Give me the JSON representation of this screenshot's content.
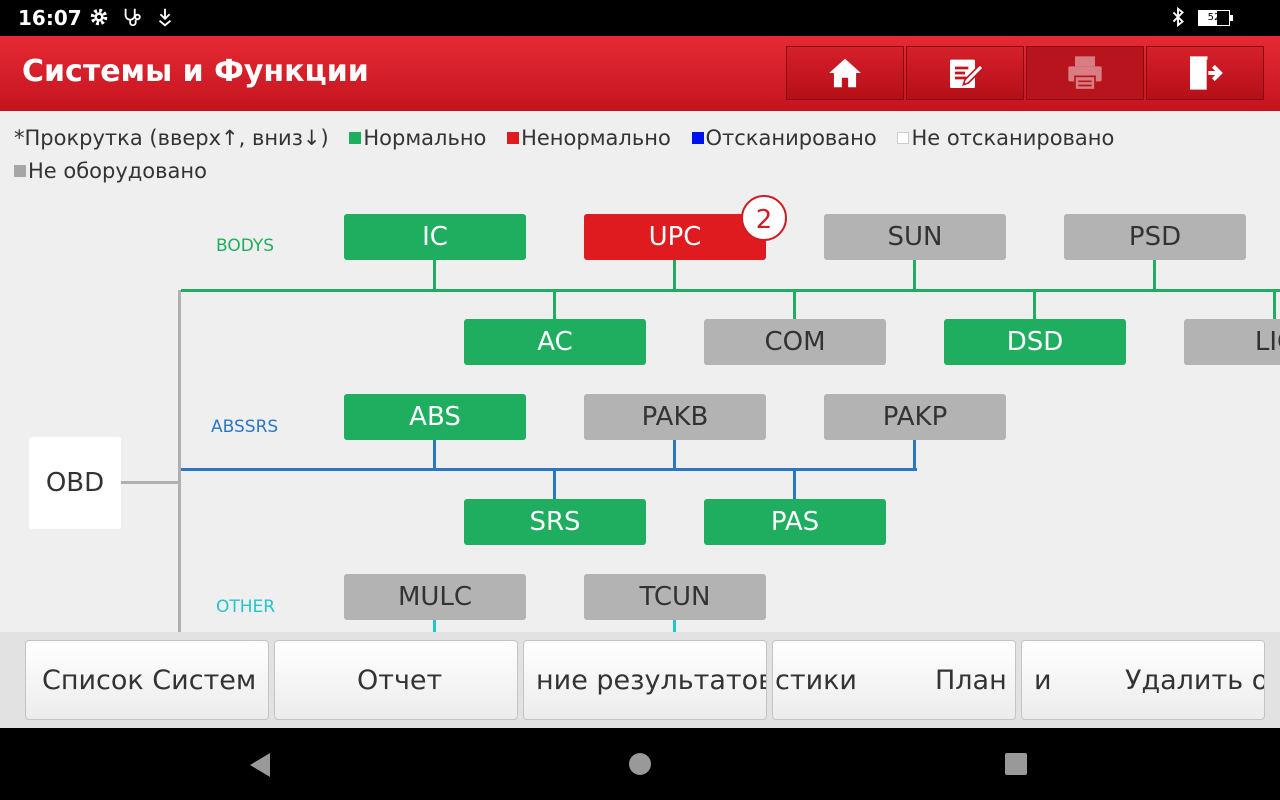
{
  "status_bar": {
    "time": "16:07",
    "icons": [
      "gear-icon",
      "stethoscope-icon",
      "download-icon"
    ],
    "right_icons": [
      "bluetooth-icon"
    ],
    "battery": "52"
  },
  "header": {
    "title": "Системы и Функции",
    "buttons": [
      "home-icon",
      "edit-icon",
      "print-icon",
      "exit-icon"
    ]
  },
  "legend": {
    "scroll_hint": "*Прокрутка (вверх↑, вниз↓)",
    "normal": "Нормально",
    "abnormal": "Ненормально",
    "scanned": "Отсканировано",
    "not_scanned": "Не отсканировано",
    "not_equipped": "Не оборудовано",
    "colors": {
      "normal": "#1fae5f",
      "abnormal": "#e01b1f",
      "scanned": "#0011ee",
      "not_scanned": "#ffffff",
      "not_equipped": "#a6a6a6"
    }
  },
  "diagram": {
    "obd_label": "OBD",
    "groups": {
      "bodys": {
        "label": "BODYS",
        "color": "#1fae5f",
        "nodes": {
          "ic": "IC",
          "upc": "UPC",
          "sun": "SUN",
          "psd": "PSD",
          "ac": "AC",
          "com": "COM",
          "dsd": "DSD",
          "lic": "LIC"
        }
      },
      "abssrs": {
        "label": "ABSSRS",
        "color": "#2a77c4",
        "nodes": {
          "abs": "ABS",
          "pakb": "PAKB",
          "pakp": "PAKP",
          "srs": "SRS",
          "pas": "PAS"
        }
      },
      "other": {
        "label": "OTHER",
        "color": "#22c5cc",
        "nodes": {
          "mulc": "MULC",
          "tcun": "TCUN"
        }
      }
    },
    "upc_fault_count": "2"
  },
  "bottom_buttons": {
    "system_list": "Список Систем",
    "report": "Отчет",
    "results": "ние результатов",
    "plan_left": "стики",
    "plan_right": "План",
    "delete_left": "и",
    "delete_right": "Удалить о"
  }
}
